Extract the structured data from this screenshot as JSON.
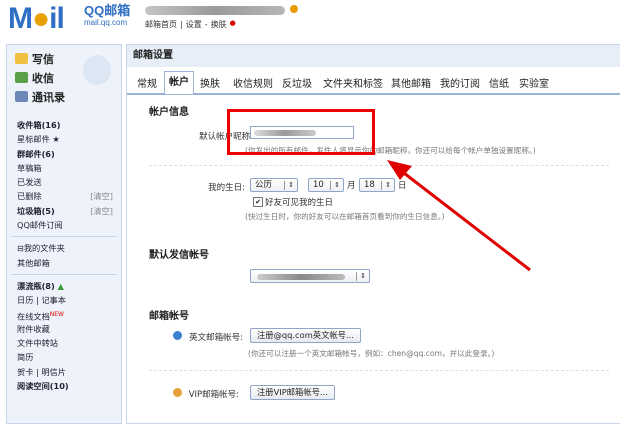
{
  "header": {
    "logo_main": "M",
    "logo_o": "●",
    "logo_rest": "il",
    "logo_qq": "QQ邮箱",
    "logo_url": "mail.qq.com",
    "links": [
      "邮箱首页",
      "|",
      "设置",
      "-",
      "换肤"
    ],
    "new_mark": "●"
  },
  "sidebar": {
    "write": "写信",
    "receive": "收信",
    "contacts": "通讯录",
    "items": [
      {
        "label": "收件箱(16)",
        "bold": true
      },
      {
        "label": "星标邮件 ★",
        "bold": false
      },
      {
        "label": "群邮件(6)",
        "bold": true
      },
      {
        "label": "草稿箱",
        "bold": false
      },
      {
        "label": "已发送",
        "bold": false
      },
      {
        "label": "已删除",
        "bold": false,
        "extra": "[清空]"
      },
      {
        "label": "垃圾箱(5)",
        "bold": true,
        "extra": "[清空]"
      },
      {
        "label": "QQ邮件订阅",
        "bold": false
      }
    ],
    "folders": [
      {
        "label": "⊟我的文件夹",
        "bold": false
      },
      {
        "label": "其他邮箱",
        "bold": false
      }
    ],
    "apps": [
      {
        "label": "漂流瓶(8)",
        "bold": true
      },
      {
        "label": "日历 | 记事本",
        "bold": false
      },
      {
        "label": "在线文档",
        "bold": false,
        "badge": "NEW"
      },
      {
        "label": "附件收藏",
        "bold": false
      },
      {
        "label": "文件中转站",
        "bold": false
      },
      {
        "label": "简历",
        "bold": false
      },
      {
        "label": "贺卡 | 明信片",
        "bold": false
      },
      {
        "label": "阅读空间(10)",
        "bold": true
      }
    ]
  },
  "main": {
    "title": "邮箱设置",
    "tabs": [
      "常规",
      "帐户",
      "换肤",
      "收信规则",
      "反垃圾",
      "文件夹和标签",
      "其他邮箱",
      "我的订阅",
      "信纸",
      "实验室"
    ],
    "active_tab": "帐户",
    "account_info": {
      "section": "帐户信息",
      "nickname_label": "默认帐户昵称:",
      "nickname_hint": "(你发出的所有邮件，发件人将显示你的邮箱昵称，你还可以给每个帐户单独设置昵称。)",
      "birthday_label": "我的生日:",
      "calendar": "公历",
      "month": "10",
      "month_unit": "月",
      "day": "18",
      "day_unit": "日",
      "friends_visible": "好友可见我的生日",
      "birthday_hint": "(快过生日时，你的好友可以在邮箱首页看到你的生日信息。)"
    },
    "default_sender": {
      "section": "默认发信帐号"
    },
    "mailbox_accounts": {
      "section": "邮箱帐号",
      "english_label": "英文邮箱帐号:",
      "english_button": "注册@qq.com英文帐号...",
      "english_hint": "(你还可以注册一个英文邮箱帐号，例如：chen@qq.com，并以此登录。)",
      "vip_label": "VIP邮箱帐号:",
      "vip_button": "注册VIP邮箱帐号..."
    }
  },
  "annotation": {
    "color": "#e00000"
  }
}
